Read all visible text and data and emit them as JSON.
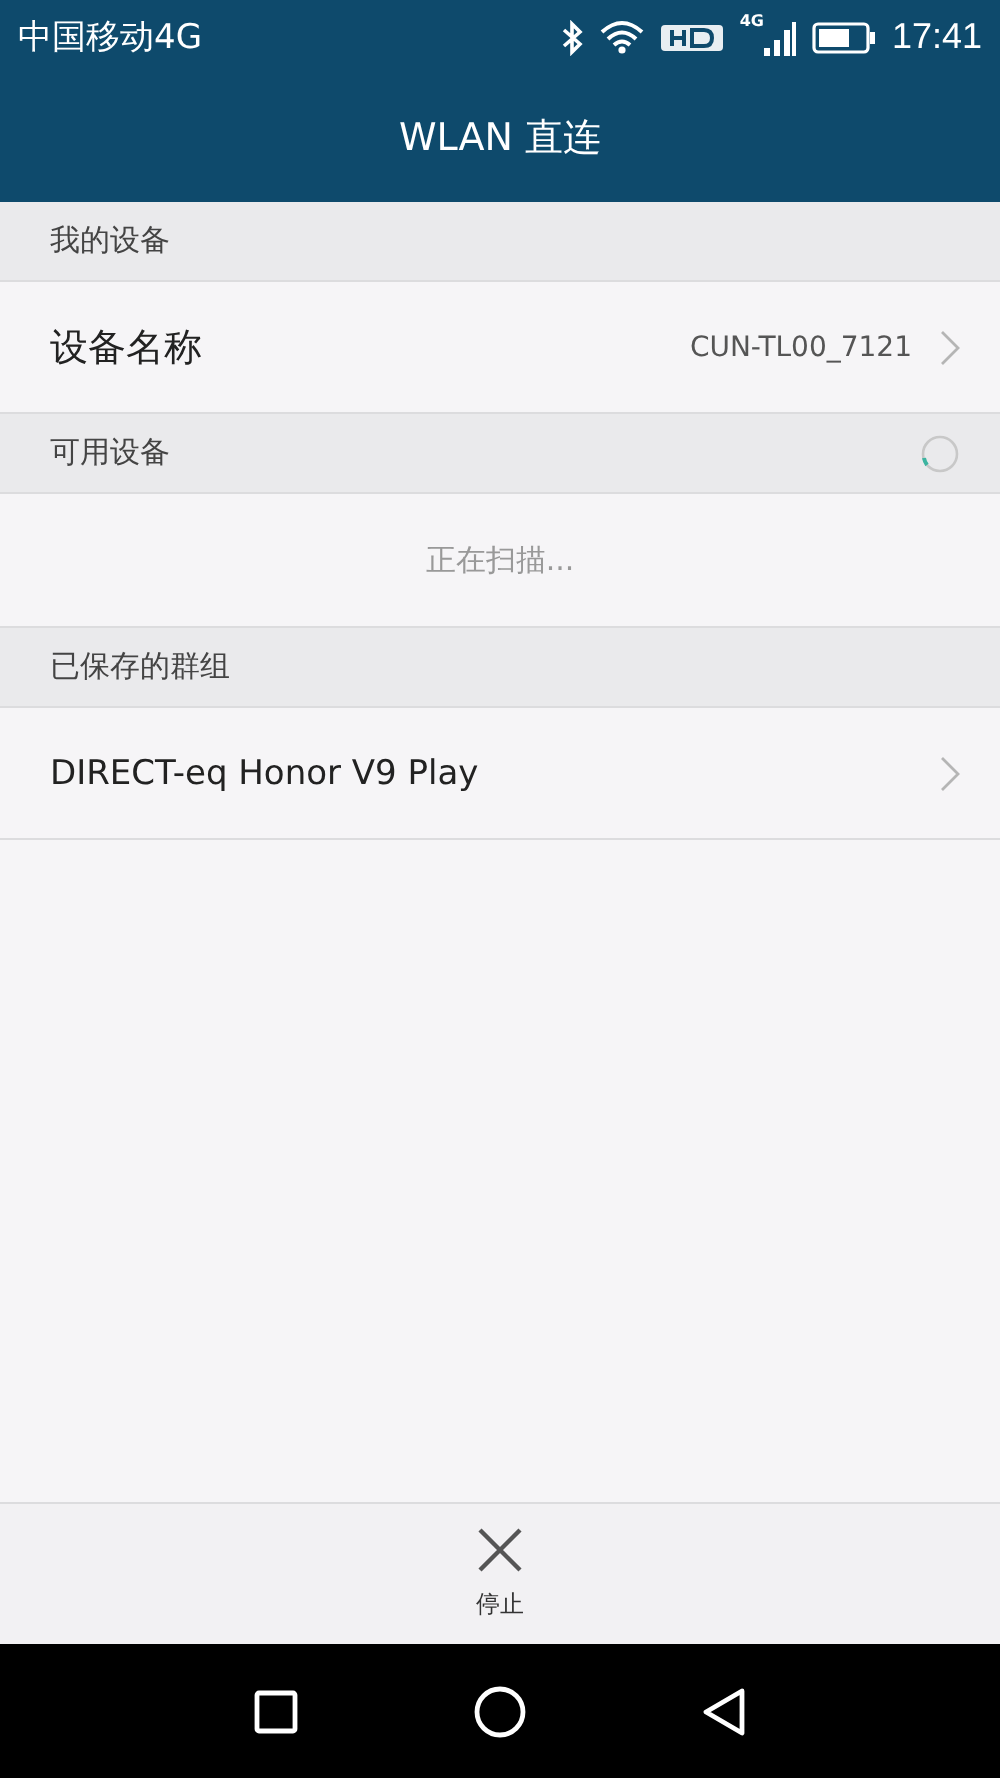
{
  "status_bar": {
    "carrier": "中国移动4G",
    "network_badge": "4G",
    "time": "17:41"
  },
  "title": "WLAN 直连",
  "sections": [
    {
      "header": "我的设备",
      "loading": false,
      "rows": [
        {
          "kind": "item",
          "label": "设备名称",
          "value": "CUN-TL00_7121"
        }
      ]
    },
    {
      "header": "可用设备",
      "loading": true,
      "rows": [
        {
          "kind": "message",
          "label": "正在扫描..."
        }
      ]
    },
    {
      "header": "已保存的群组",
      "loading": false,
      "rows": [
        {
          "kind": "item",
          "label": "DIRECT-eq Honor V9 Play"
        }
      ]
    }
  ],
  "toolbar": {
    "label": "停止"
  }
}
